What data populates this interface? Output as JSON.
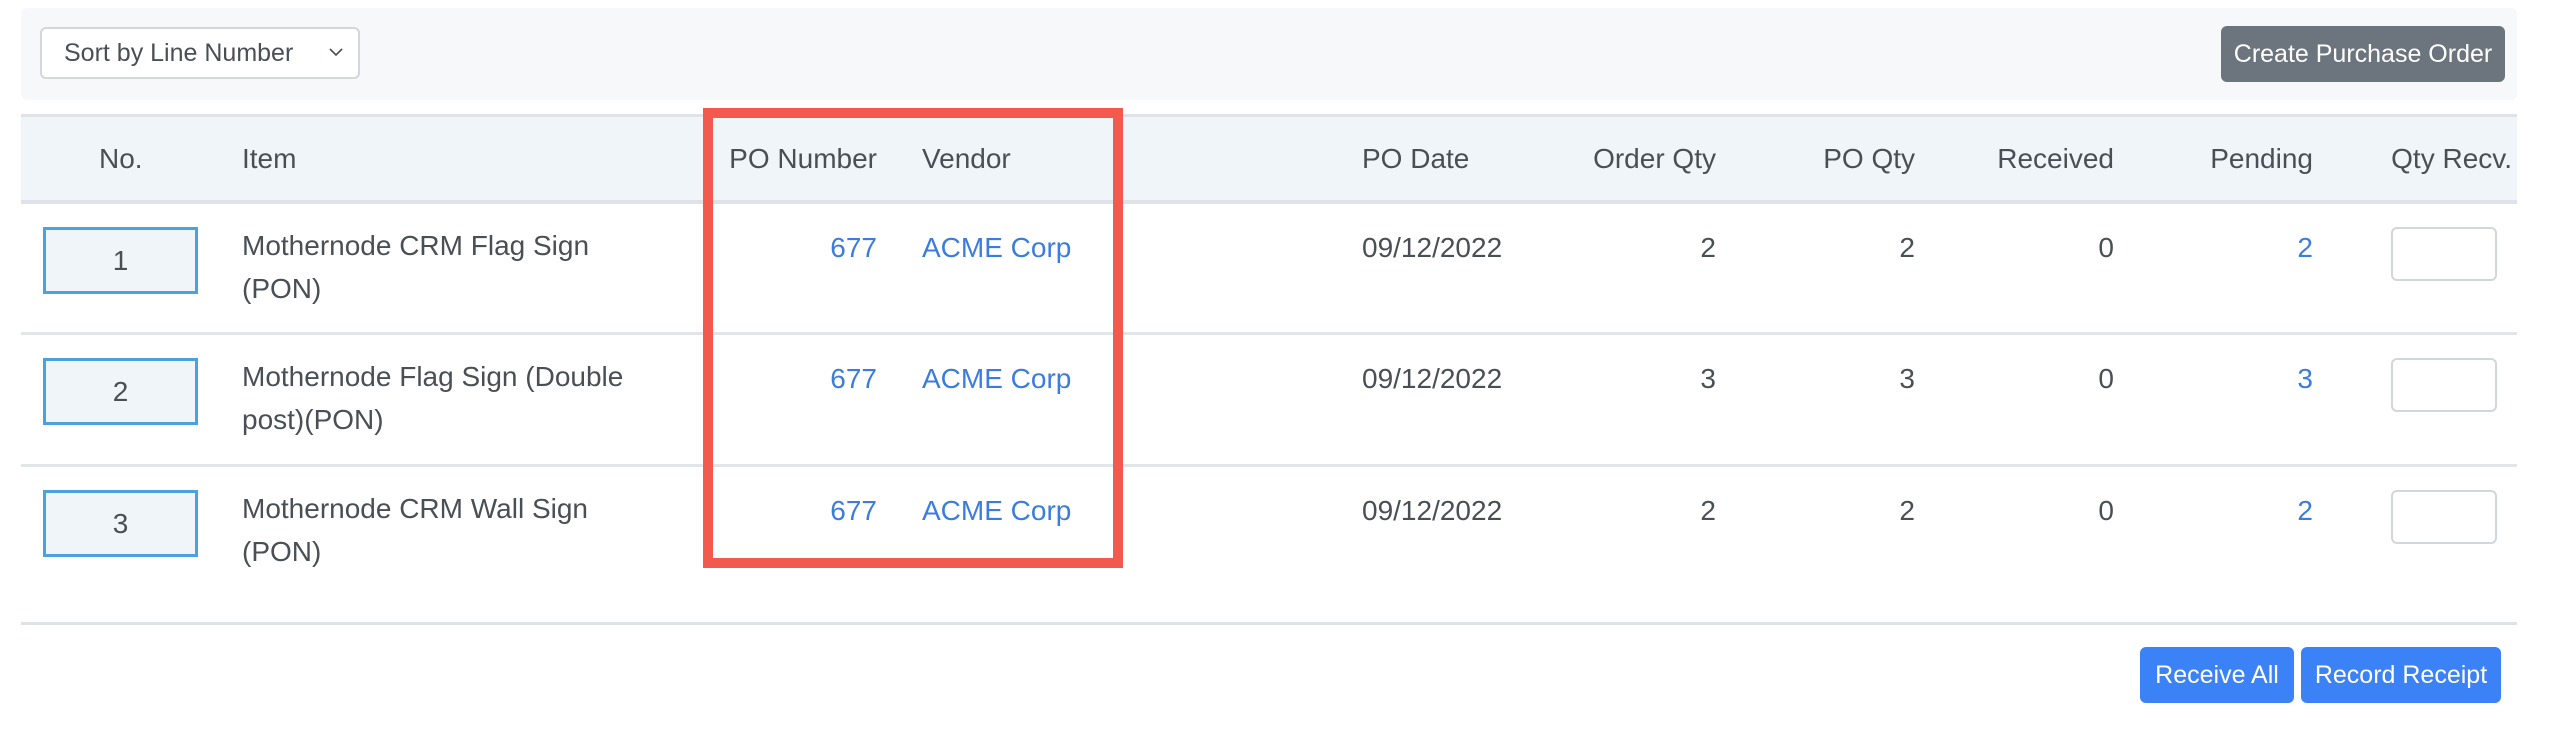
{
  "toolbar": {
    "sort_select": {
      "value": "Sort by Line Number",
      "icon": "chevron-down-icon"
    },
    "create_po_label": "Create Purchase Order"
  },
  "table": {
    "headers": {
      "no": "No.",
      "item": "Item",
      "po_number": "PO Number",
      "vendor": "Vendor",
      "po_date": "PO Date",
      "order_qty": "Order Qty",
      "po_qty": "PO Qty",
      "received": "Received",
      "pending": "Pending",
      "qty_recv": "Qty Recv."
    },
    "rows": [
      {
        "no": "1",
        "item": "Mothernode CRM Flag Sign (PON)",
        "po_number": "677",
        "vendor": "ACME Corp",
        "po_date": "09/12/2022",
        "order_qty": "2",
        "po_qty": "2",
        "received": "0",
        "pending": "2",
        "qty_recv": ""
      },
      {
        "no": "2",
        "item": "Mothernode Flag Sign (Double post)(PON)",
        "po_number": "677",
        "vendor": "ACME Corp",
        "po_date": "09/12/2022",
        "order_qty": "3",
        "po_qty": "3",
        "received": "0",
        "pending": "3",
        "qty_recv": ""
      },
      {
        "no": "3",
        "item": "Mothernode CRM Wall Sign (PON)",
        "po_number": "677",
        "vendor": "ACME Corp",
        "po_date": "09/12/2022",
        "order_qty": "2",
        "po_qty": "2",
        "received": "0",
        "pending": "2",
        "qty_recv": ""
      }
    ]
  },
  "footer": {
    "receive_all_label": "Receive All",
    "record_receipt_label": "Record Receipt"
  },
  "colors": {
    "link": "#3b7ddd",
    "primary": "#3b82f6",
    "secondary": "#6c747d",
    "highlight": "#f25a4e"
  }
}
